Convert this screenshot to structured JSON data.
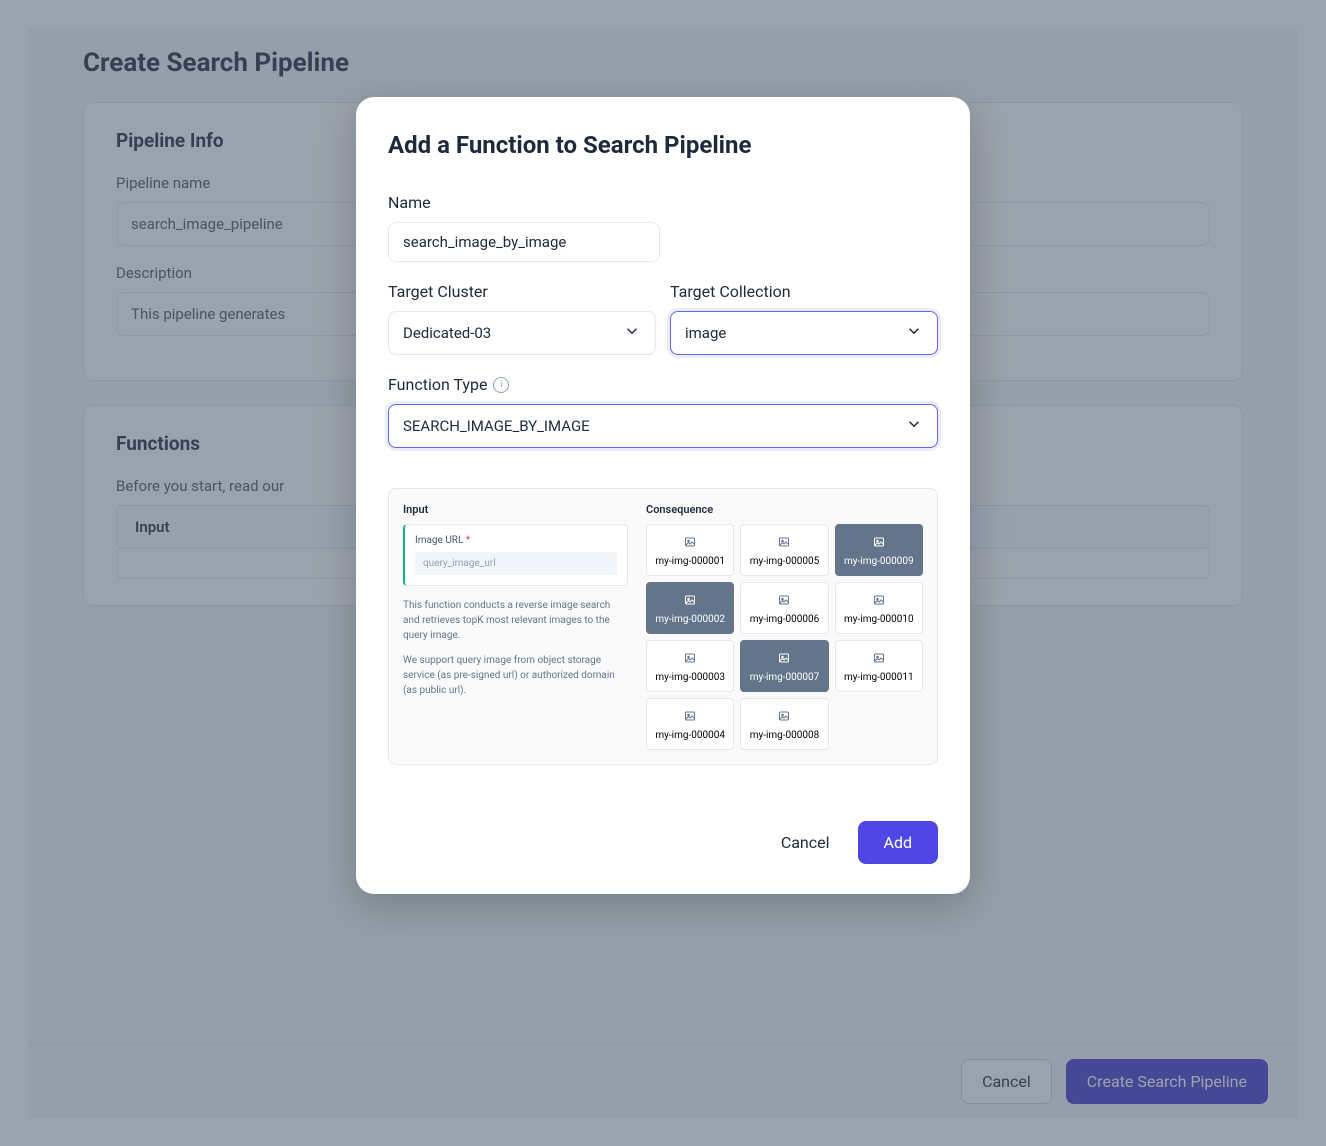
{
  "bg": {
    "page_title": "Create Search Pipeline",
    "section_info_title": "Pipeline Info",
    "pipeline_name_label": "Pipeline name",
    "pipeline_name_value": "search_image_pipeline",
    "description_label": "Description",
    "description_value": "This pipeline generates",
    "section_functions_title": "Functions",
    "functions_hint": "Before you start, read our",
    "input_header": "Input",
    "cancel": "Cancel",
    "create": "Create Search Pipeline"
  },
  "modal": {
    "title": "Add a Function to Search Pipeline",
    "name_label": "Name",
    "name_value": "search_image_by_image",
    "cluster_label": "Target Cluster",
    "cluster_value": "Dedicated-03",
    "collection_label": "Target Collection",
    "collection_value": "image",
    "fn_type_label": "Function Type",
    "fn_type_value": "SEARCH_IMAGE_BY_IMAGE",
    "preview": {
      "input_header": "Input",
      "image_url_label": "Image URL",
      "image_url_placeholder": "query_image_url",
      "desc1": "This function conducts a reverse image search and retrieves topK most relevant images to the query image.",
      "desc2": "We support query image from object storage service (as pre-signed url) or authorized domain (as public url).",
      "consequence_header": "Consequence",
      "cards": [
        {
          "name": "my-img-000001",
          "sel": false
        },
        {
          "name": "my-img-000005",
          "sel": false
        },
        {
          "name": "my-img-000009",
          "sel": true
        },
        {
          "name": "my-img-000002",
          "sel": true
        },
        {
          "name": "my-img-000006",
          "sel": false
        },
        {
          "name": "my-img-000010",
          "sel": false
        },
        {
          "name": "my-img-000003",
          "sel": false
        },
        {
          "name": "my-img-000007",
          "sel": true
        },
        {
          "name": "my-img-000011",
          "sel": false
        },
        {
          "name": "my-img-000004",
          "sel": false
        },
        {
          "name": "my-img-000008",
          "sel": false
        }
      ]
    },
    "cancel": "Cancel",
    "add": "Add"
  }
}
